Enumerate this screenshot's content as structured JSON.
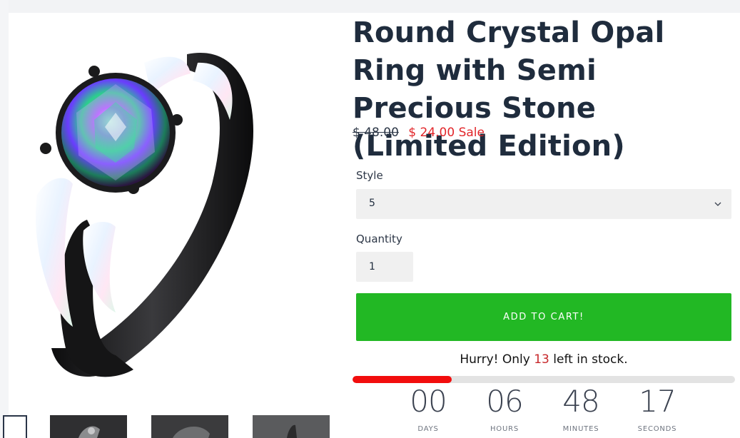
{
  "product": {
    "title": "Round Crystal Opal Ring with Semi Precious Stone (Limited Edition)",
    "price_compare": "$ 48.00",
    "price_sale": "$ 24.00",
    "sale_tag": "Sale"
  },
  "options": {
    "style_label": "Style",
    "style_value": "5",
    "quantity_label": "Quantity",
    "quantity_value": "1"
  },
  "cart": {
    "button_label": "ADD TO CART!"
  },
  "stock": {
    "prefix": "Hurry! Only",
    "count": "13",
    "suffix": "left in stock.",
    "level": 0.26,
    "bar_color": "#f20d0d"
  },
  "countdown": {
    "days": "00",
    "days_label": "DAYS",
    "hours": "06",
    "hours_label": "HOURS",
    "minutes": "48",
    "minutes_label": "MINUTES",
    "seconds": "17",
    "seconds_label": "SECONDS"
  },
  "colors": {
    "accent_green": "#22b824",
    "sale_red": "#e2262a",
    "title": "#1f2c3d"
  },
  "icons": {
    "select_chevron": "chevron-down-icon"
  }
}
